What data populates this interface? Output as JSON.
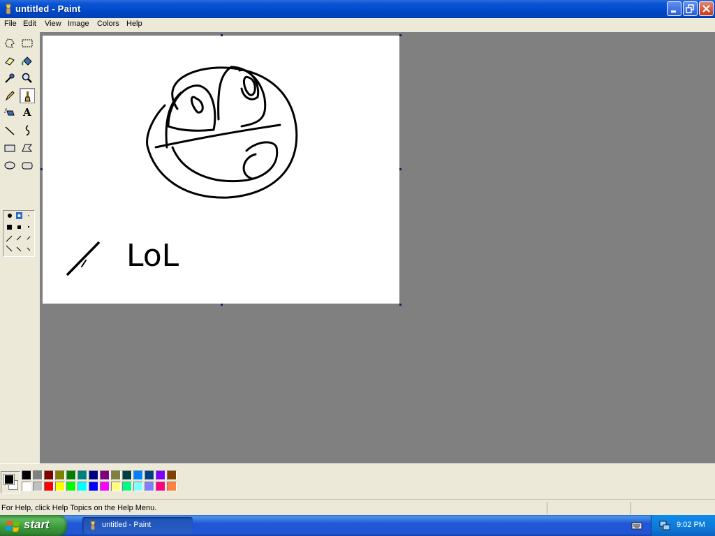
{
  "window": {
    "title": "untitled - Paint",
    "controls": {
      "minimize": "minimize-icon",
      "maximize": "restore-icon",
      "close": "close-icon"
    }
  },
  "menu": [
    "File",
    "Edit",
    "View",
    "Image",
    "Colors",
    "Help"
  ],
  "tools": [
    {
      "name": "free-form-select-tool",
      "icon": "free-form-select-icon"
    },
    {
      "name": "select-tool",
      "icon": "rectangle-select-icon"
    },
    {
      "name": "eraser-tool",
      "icon": "eraser-icon"
    },
    {
      "name": "fill-tool",
      "icon": "paint-bucket-icon"
    },
    {
      "name": "pick-color-tool",
      "icon": "eyedropper-icon"
    },
    {
      "name": "magnifier-tool",
      "icon": "magnifier-icon"
    },
    {
      "name": "pencil-tool",
      "icon": "pencil-icon"
    },
    {
      "name": "brush-tool",
      "icon": "brush-icon",
      "active": true
    },
    {
      "name": "airbrush-tool",
      "icon": "airbrush-icon"
    },
    {
      "name": "text-tool",
      "icon": "text-icon",
      "glyph": "A"
    },
    {
      "name": "line-tool",
      "icon": "line-icon"
    },
    {
      "name": "curve-tool",
      "icon": "curve-icon"
    },
    {
      "name": "rectangle-tool",
      "icon": "rectangle-icon"
    },
    {
      "name": "polygon-tool",
      "icon": "polygon-icon"
    },
    {
      "name": "ellipse-tool",
      "icon": "ellipse-icon"
    },
    {
      "name": "rounded-rectangle-tool",
      "icon": "rounded-rectangle-icon"
    }
  ],
  "canvas": {
    "text": "LoL"
  },
  "colors": {
    "foreground": "#000000",
    "background": "#ffffff",
    "palette_top": [
      "#000000",
      "#808080",
      "#800000",
      "#808000",
      "#008000",
      "#008080",
      "#000080",
      "#800080",
      "#808040",
      "#004040",
      "#0080ff",
      "#004080",
      "#8000ff",
      "#804000"
    ],
    "palette_bottom": [
      "#ffffff",
      "#c0c0c0",
      "#ff0000",
      "#ffff00",
      "#00ff00",
      "#00ffff",
      "#0000ff",
      "#ff00ff",
      "#ffff80",
      "#00ff80",
      "#80ffff",
      "#8080ff",
      "#ff0080",
      "#ff8040"
    ]
  },
  "status": {
    "help_text": "For Help, click Help Topics on the Help Menu."
  },
  "taskbar": {
    "start_label": "start",
    "task_label": "untitled - Paint",
    "clock": "9:02 PM"
  }
}
